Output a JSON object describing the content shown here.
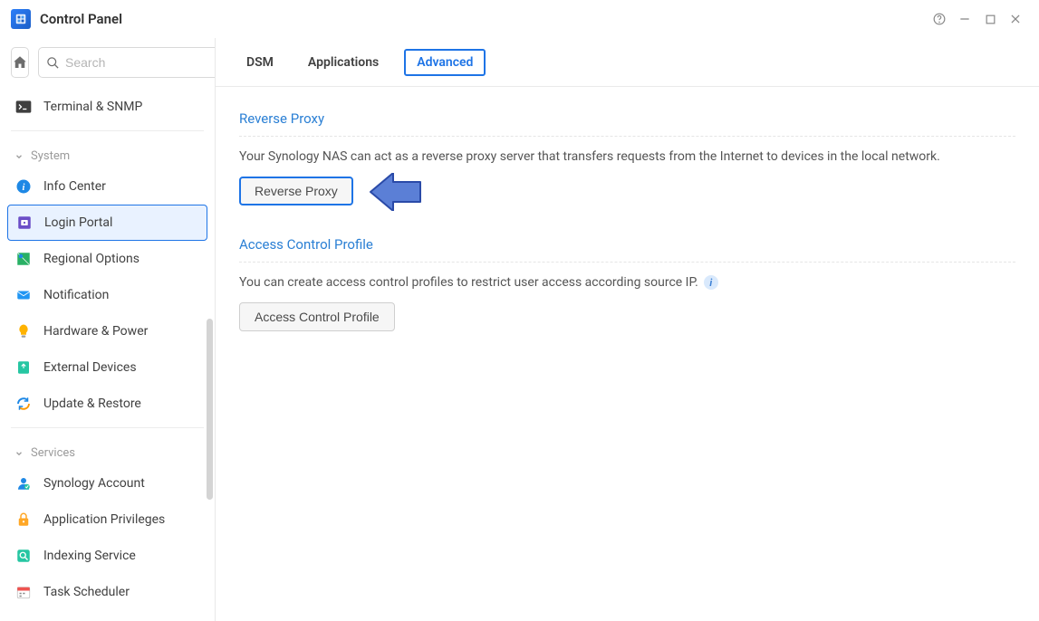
{
  "titlebar": {
    "title": "Control Panel"
  },
  "sidebar": {
    "search_placeholder": "Search",
    "pinned": {
      "terminal_snmp": "Terminal & SNMP"
    },
    "groups": {
      "system": {
        "label": "System",
        "items": {
          "info_center": "Info Center",
          "login_portal": "Login Portal",
          "regional_options": "Regional Options",
          "notification": "Notification",
          "hardware_power": "Hardware & Power",
          "external_devices": "External Devices",
          "update_restore": "Update & Restore"
        }
      },
      "services": {
        "label": "Services",
        "items": {
          "synology_account": "Synology Account",
          "application_privileges": "Application Privileges",
          "indexing_service": "Indexing Service",
          "task_scheduler": "Task Scheduler"
        }
      }
    }
  },
  "tabs": {
    "dsm": "DSM",
    "applications": "Applications",
    "advanced": "Advanced"
  },
  "sections": {
    "reverse_proxy": {
      "title": "Reverse Proxy",
      "desc": "Your Synology NAS can act as a reverse proxy server that transfers requests from the Internet to devices in the local network.",
      "button": "Reverse Proxy"
    },
    "acp": {
      "title": "Access Control Profile",
      "desc": "You can create access control profiles to restrict user access according source IP.",
      "button": "Access Control Profile"
    }
  }
}
